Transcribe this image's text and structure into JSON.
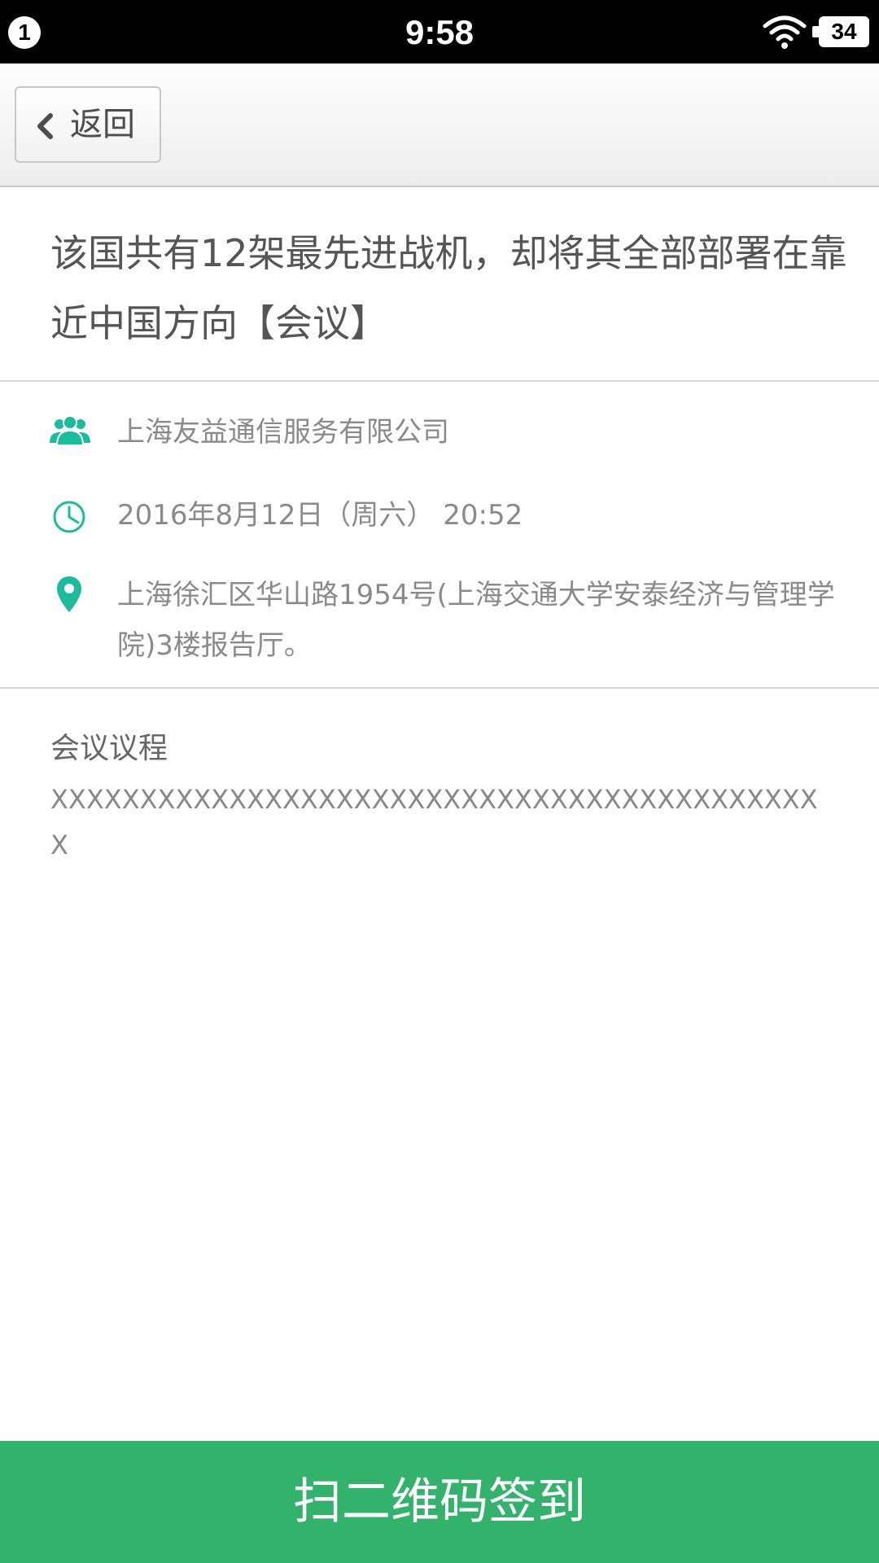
{
  "status_bar": {
    "notification_count": "1",
    "time": "9:58",
    "battery_level": "34",
    "wifi_icon": "wifi-icon"
  },
  "header": {
    "back_label": "返回",
    "back_icon": "chevron-left-icon"
  },
  "event": {
    "title": "该国共有12架最先进战机，却将其全部部署在靠近中国方向【会议】",
    "organizer": "上海友益通信服务有限公司",
    "datetime": "2016年8月12日（周六） 20:52",
    "location": "上海徐汇区华山路1954号(上海交通大学安泰经济与管理学院)3楼报告厅。",
    "icons": {
      "organizer": "people-icon",
      "datetime": "clock-icon",
      "location": "map-pin-icon"
    },
    "accent_color": "#1abc9c"
  },
  "agenda": {
    "heading": "会议议程",
    "content": "XXXXXXXXXXXXXXXXXXXXXXXXXXXXXXXXXXXXXXXXXXXX"
  },
  "checkin_button": {
    "label": "扫二维码签到",
    "color": "#33b26c"
  }
}
